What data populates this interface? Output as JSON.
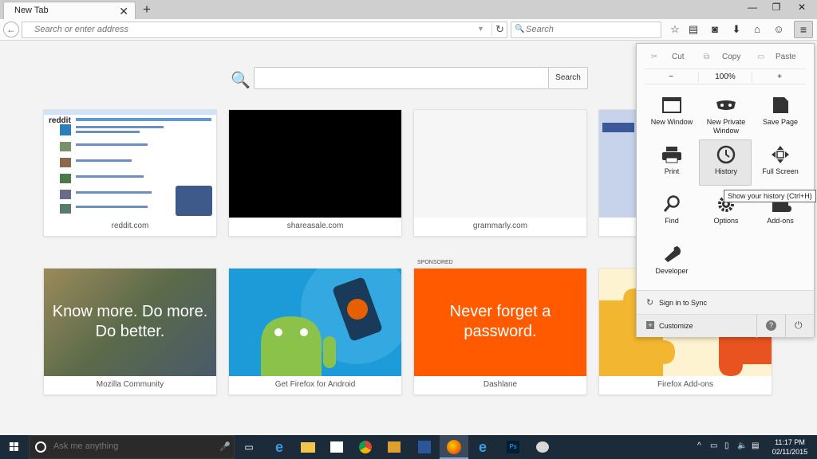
{
  "tab": {
    "title": "New Tab",
    "close": "✕",
    "new": "+"
  },
  "window": {
    "minimize": "—",
    "maximize": "❐",
    "close": "✕"
  },
  "nav": {
    "url_placeholder": "Search or enter address",
    "search_placeholder": "Search"
  },
  "page": {
    "search_button": "Search",
    "sponsored": "SPONSORED",
    "tiles": [
      {
        "label": "reddit.com"
      },
      {
        "label": "shareasale.com"
      },
      {
        "label": "grammarly.com"
      },
      {
        "label": ""
      },
      {
        "label": "Mozilla Community",
        "text": "Know more. Do more. Do better."
      },
      {
        "label": "Get Firefox for Android"
      },
      {
        "label": "Dashlane",
        "text": "Never forget a password."
      },
      {
        "label": "Firefox Add-ons"
      }
    ],
    "reddit_logo": "reddit"
  },
  "menu": {
    "cut": "Cut",
    "copy": "Copy",
    "paste": "Paste",
    "zoom_out": "−",
    "zoom_level": "100%",
    "zoom_in": "+",
    "items": [
      {
        "label": "New Window",
        "icon": "window-icon"
      },
      {
        "label": "New Private Window",
        "icon": "mask-icon"
      },
      {
        "label": "Save Page",
        "icon": "page-icon"
      },
      {
        "label": "Print",
        "icon": "printer-icon"
      },
      {
        "label": "History",
        "icon": "clock-icon"
      },
      {
        "label": "Full Screen",
        "icon": "fullscreen-icon"
      },
      {
        "label": "Find",
        "icon": "magnifier-icon"
      },
      {
        "label": "Options",
        "icon": "gear-icon"
      },
      {
        "label": "Add-ons",
        "icon": "puzzle-icon"
      },
      {
        "label": "Developer",
        "icon": "wrench-icon"
      }
    ],
    "sync": "Sign in to Sync",
    "customize": "Customize",
    "tooltip": "Show your history (Ctrl+H)"
  },
  "taskbar": {
    "cortana_placeholder": "Ask me anything",
    "time": "11:17 PM",
    "date": "02/11/2015"
  }
}
